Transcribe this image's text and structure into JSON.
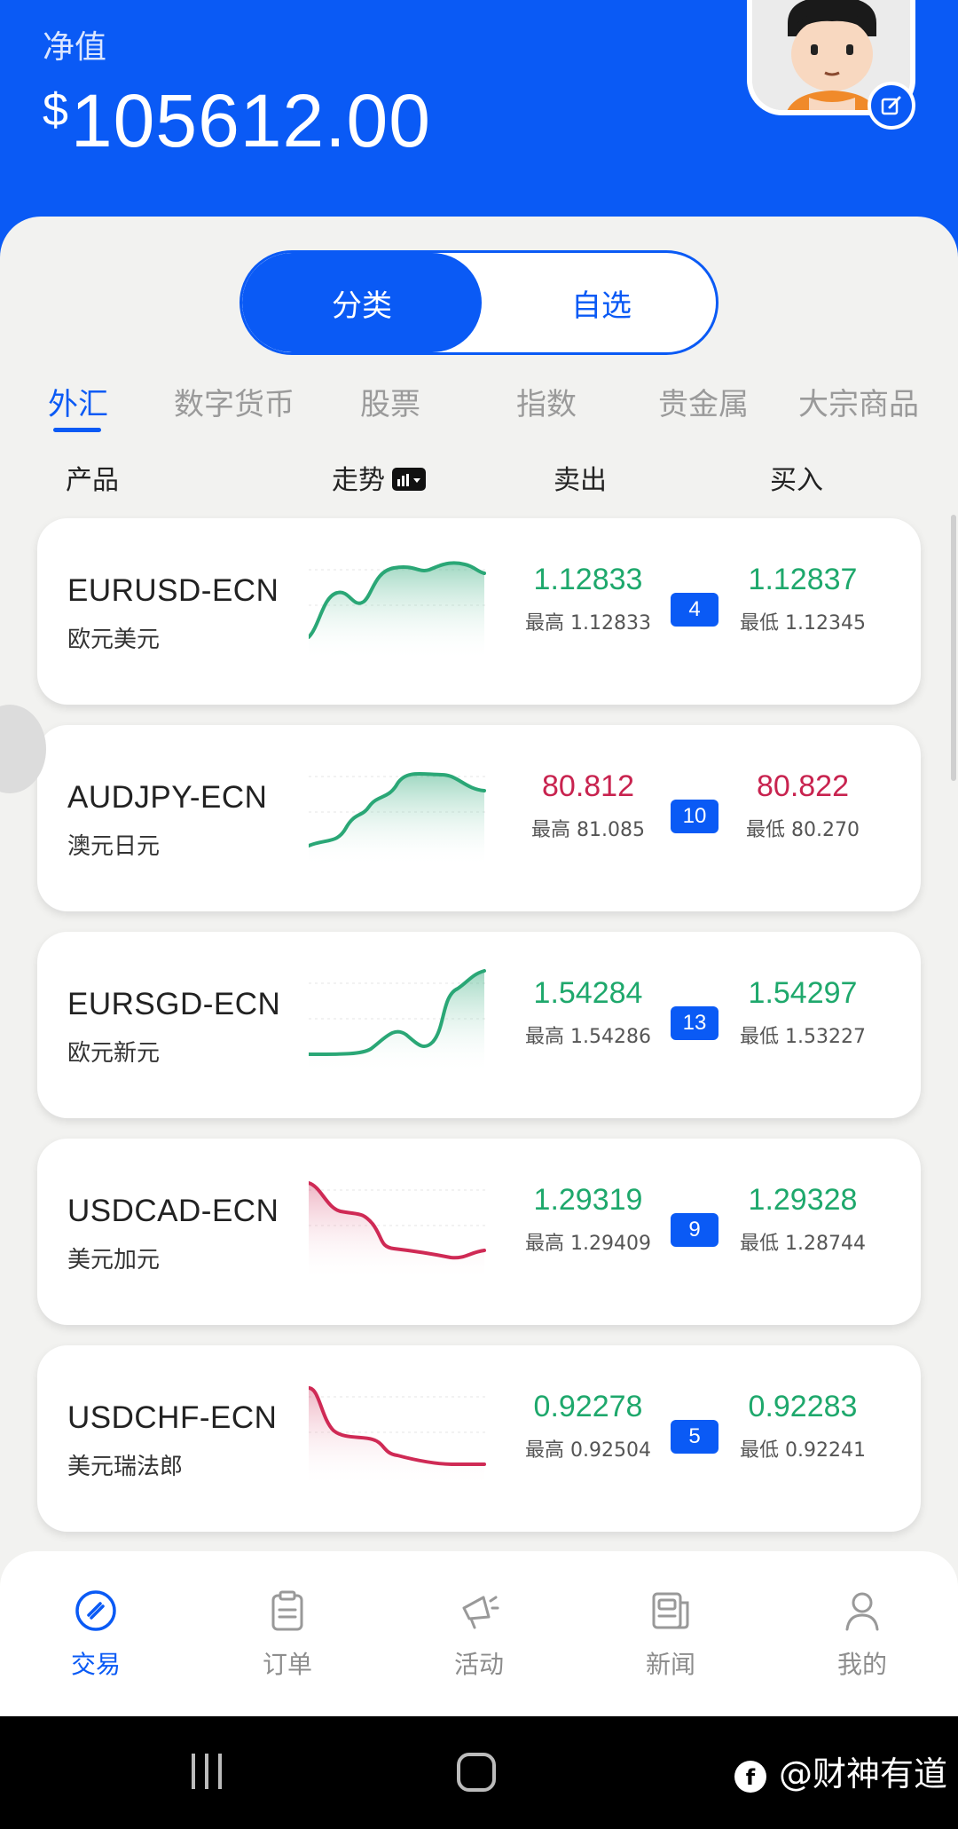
{
  "header": {
    "label": "净值",
    "currency": "$",
    "value": "105612.00"
  },
  "segment": {
    "tabs": [
      "分类",
      "自选"
    ],
    "active": 0
  },
  "categories": [
    "外汇",
    "数字货币",
    "股票",
    "指数",
    "贵金属",
    "大宗商品"
  ],
  "columns": {
    "product": "产品",
    "trend": "走势",
    "sell": "卖出",
    "buy": "买入"
  },
  "colors": {
    "brand": "#0a5af5",
    "up": "#1ea86c",
    "down": "#c8234f"
  },
  "rows": [
    {
      "symbol": "EURUSD-ECN",
      "name": "欧元美元",
      "sell": "1.12833",
      "sell_sub": "最高 1.12833",
      "spread": "4",
      "buy": "1.12837",
      "buy_sub": "最低 1.12345",
      "price_color": "up",
      "trend": "up"
    },
    {
      "symbol": "AUDJPY-ECN",
      "name": "澳元日元",
      "sell": "80.812",
      "sell_sub": "最高 81.085",
      "spread": "10",
      "buy": "80.822",
      "buy_sub": "最低 80.270",
      "price_color": "down",
      "trend": "up"
    },
    {
      "symbol": "EURSGD-ECN",
      "name": "欧元新元",
      "sell": "1.54284",
      "sell_sub": "最高 1.54286",
      "spread": "13",
      "buy": "1.54297",
      "buy_sub": "最低 1.53227",
      "price_color": "up",
      "trend": "up"
    },
    {
      "symbol": "USDCAD-ECN",
      "name": "美元加元",
      "sell": "1.29319",
      "sell_sub": "最高 1.29409",
      "spread": "9",
      "buy": "1.29328",
      "buy_sub": "最低 1.28744",
      "price_color": "up",
      "trend": "down"
    },
    {
      "symbol": "USDCHF-ECN",
      "name": "美元瑞法郎",
      "sell": "0.92278",
      "sell_sub": "最高 0.92504",
      "spread": "5",
      "buy": "0.92283",
      "buy_sub": "最低 0.92241",
      "price_color": "up",
      "trend": "down"
    }
  ],
  "tabbar": [
    {
      "label": "交易",
      "icon": "trade-icon",
      "active": true
    },
    {
      "label": "订单",
      "icon": "orders-icon",
      "active": false
    },
    {
      "label": "活动",
      "icon": "megaphone-icon",
      "active": false
    },
    {
      "label": "新闻",
      "icon": "news-icon",
      "active": false
    },
    {
      "label": "我的",
      "icon": "profile-icon",
      "active": false
    }
  ],
  "watermark": "@财神有道"
}
